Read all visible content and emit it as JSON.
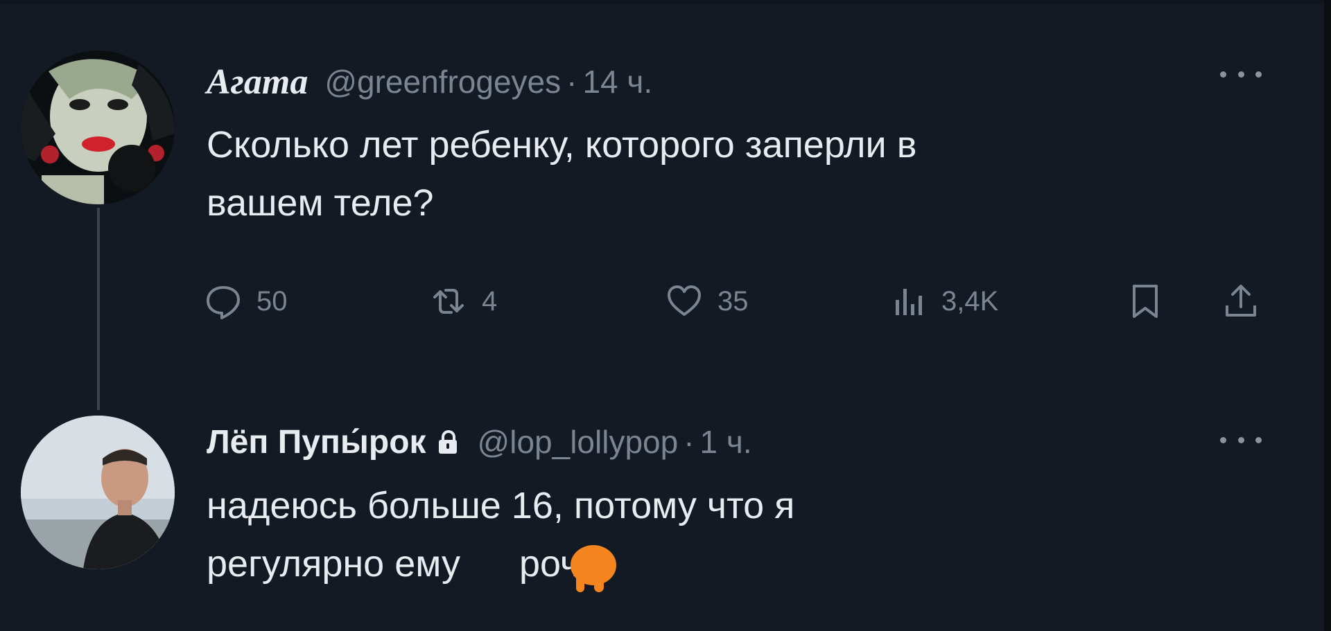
{
  "tweets": [
    {
      "name": "Агата",
      "handle": "@greenfrogeyes",
      "separator": "·",
      "time": "14 ч.",
      "text_line1": "Сколько лет ребенку, которого заперли в",
      "text_line2": "вашем теле?",
      "actions": {
        "replies": "50",
        "retweets": "4",
        "likes": "35",
        "views": "3,4K"
      }
    },
    {
      "name": "Лёп Пупы́рок",
      "handle": "@lop_lollypop",
      "separator": "·",
      "time": "1 ч.",
      "text_line1": "надеюсь больше 16, потому что я",
      "text_line2": "регулярно ему ",
      "text_line2_tail": "рочу",
      "verified_lock": "lock-icon"
    }
  ],
  "colors": {
    "background": "#131a23",
    "text_primary": "#e8ecf0",
    "text_secondary": "#7b8591",
    "thread_line": "#3a4450",
    "emoji_blob": "#f5861f"
  },
  "icons": {
    "reply": "speech-bubble-icon",
    "retweet": "retweet-icon",
    "like": "heart-icon",
    "views": "bar-chart-icon",
    "bookmark": "bookmark-icon",
    "share": "share-icon",
    "more": "more-horizontal-icon"
  }
}
